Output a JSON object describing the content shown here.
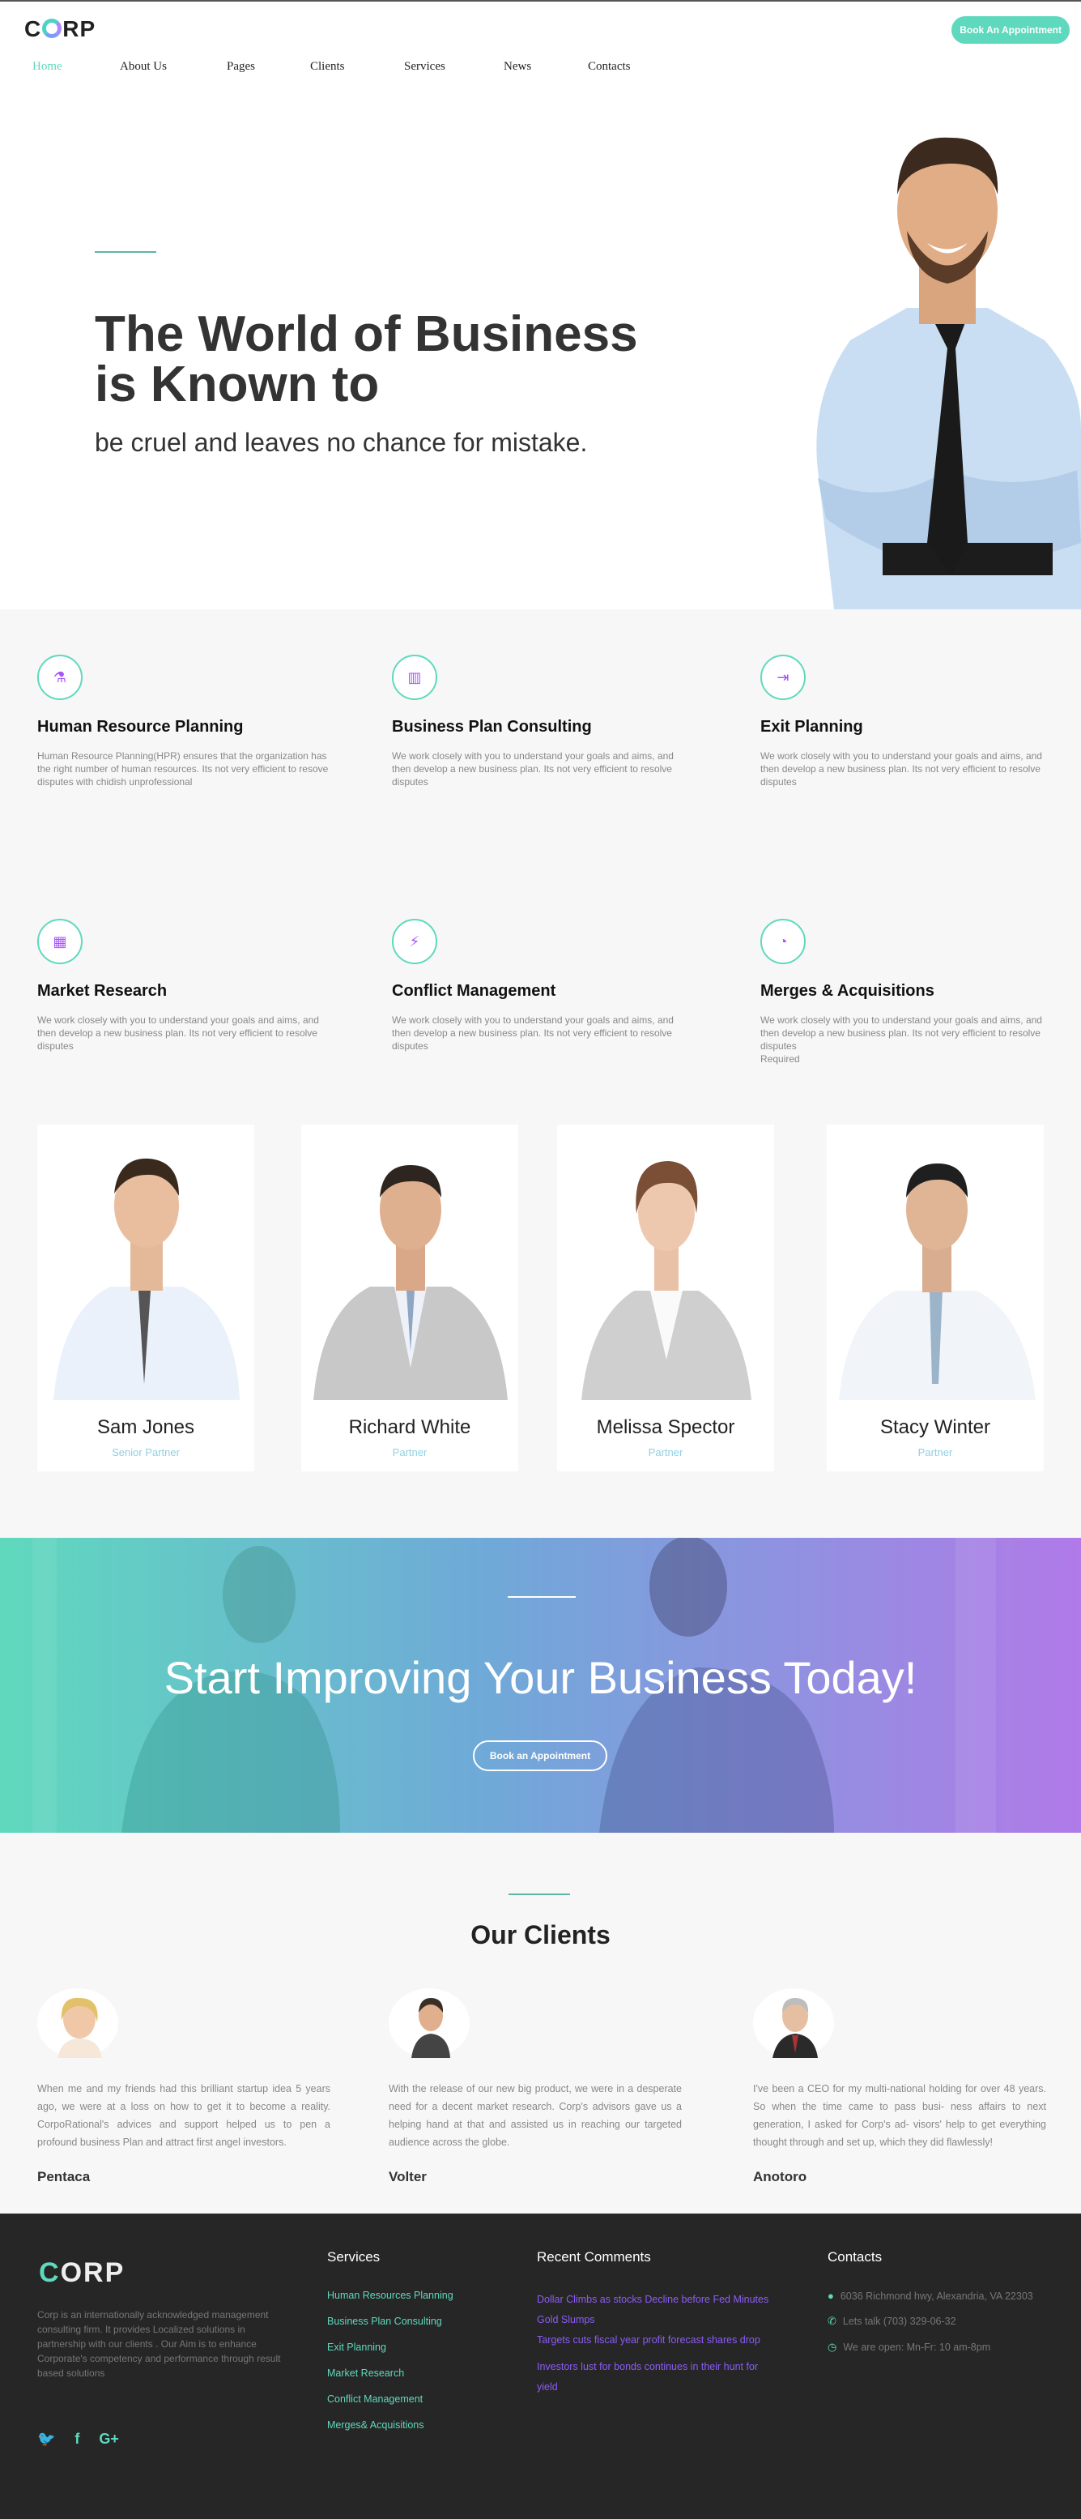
{
  "header": {
    "logo_pre": "C",
    "logo_post": "RP",
    "book_button": "Book An Appointment",
    "nav": [
      "Home",
      "About Us",
      "Pages",
      "Clients",
      "Services",
      "News",
      "Contacts"
    ]
  },
  "hero": {
    "title_line1": "The World of Business",
    "title_line2": "is Known to",
    "subtitle": "be cruel and leaves no chance for mistake."
  },
  "services": [
    {
      "title": "Human Resource Planning",
      "text": "Human Resource Planning(HPR) ensures that the organization has the right number of human resources. Its not very efficient to resove disputes with chidish unprofessional",
      "icon": "flask-icon"
    },
    {
      "title": "Business Plan Consulting",
      "text": "We work closely with you to understand your goals and aims, and then develop a new business plan. Its not very efficient to resolve disputes",
      "icon": "book-icon"
    },
    {
      "title": "Exit Planning",
      "text": "We work closely with you to understand your goals and aims, and then develop a new business plan. Its not very efficient to resolve disputes",
      "icon": "exit-icon"
    },
    {
      "title": "Market Research",
      "text": "We work closely with you to understand your goals and aims, and then develop a new business plan. Its not very efficient to resolve disputes",
      "icon": "chart-icon"
    },
    {
      "title": "Conflict Management",
      "text": "We work closely with you to understand your goals and aims, and then develop a new business plan. Its not very efficient to resolve disputes",
      "icon": "bolt-icon"
    },
    {
      "title": "Merges & Acquisitions",
      "text": "We work closely with you to understand your goals and aims, and then develop a new business plan. Its not very efficient to resolve disputes",
      "extra": "Required",
      "icon": "pie-icon"
    }
  ],
  "team": [
    {
      "name": "Sam Jones",
      "role": "Senior Partner"
    },
    {
      "name": "Richard White",
      "role": "Partner"
    },
    {
      "name": "Melissa Spector",
      "role": "Partner"
    },
    {
      "name": "Stacy Winter",
      "role": "Partner"
    }
  ],
  "banner": {
    "title": "Start Improving Your Business Today!",
    "button": "Book an Appointment"
  },
  "clients": {
    "title": "Our Clients",
    "items": [
      {
        "name": "Pentaca",
        "text": "When me and my friends had this brilliant startup idea 5 years ago, we were at a loss on how to get it to become a reality. CorpoRational's advices and support helped us to pen a profound business Plan and attract first angel investors."
      },
      {
        "name": "Volter",
        "text": "With the release of our new big product, we were in a desperate need for a decent market research. Corp's advisors gave us a helping hand at that and assisted us in reaching our targeted audience across the globe."
      },
      {
        "name": "Anotoro",
        "text": "I've been a CEO for my multi-national holding for over 48 years. So when the time came to pass busi- ness affairs to next generation, I asked for Corp's ad- visors' help to get everything thought through and set up, which they did flawlessly!"
      }
    ]
  },
  "footer": {
    "logo_pre": "C",
    "logo_post": "ORP",
    "about": "Corp is an internationally acknowledged management consulting firm. It provides Localized solutions in partnership with our clients . Our Aim is to enhance Corporate's competency and performance through result based solutions",
    "services_heading": "Services",
    "services": [
      "Human Resources Planning",
      "Business Plan Consulting",
      "Exit Planning",
      "Market Research",
      "Conflict Management",
      "Merges& Acquisitions"
    ],
    "comments_heading": "Recent Comments",
    "comments": [
      "Dollar Climbs as stocks Decline before Fed Minutes Gold Slumps",
      "Targets cuts fiscal year profit forecast shares drop",
      "Investors lust for bonds continues in their hunt for yield"
    ],
    "contacts_heading": "Contacts",
    "address": "6036 Richmond hwy, Alexandria, VA 22303",
    "phone": "Lets talk (703) 329-06-32",
    "hours": "We are open: Mn-Fr: 10 am-8pm"
  },
  "colors": {
    "accent": "#5fd9bd",
    "purple": "#8b5cf6",
    "footer_bg": "#262626"
  }
}
